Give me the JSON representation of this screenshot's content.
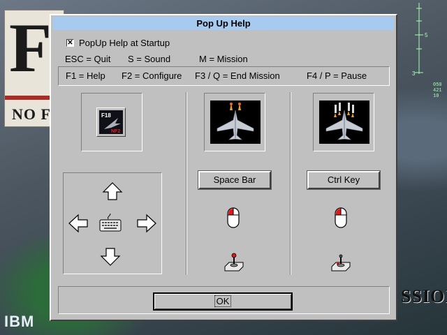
{
  "background": {
    "poster_letter": "F-",
    "poster_text": "NO F",
    "mission_text": "SSION",
    "ibm_logo": "IBM",
    "hud_numbers": [
      "050",
      "421",
      "10"
    ],
    "hud_scale": [
      "5",
      "3"
    ]
  },
  "dialog": {
    "title": "Pop Up Help",
    "startup_checkbox": {
      "label": "PopUp Help at Startup",
      "checked": true,
      "mark": "✕"
    },
    "keys_row1": [
      "ESC = Quit",
      "S = Sound",
      "M = Mission"
    ],
    "keys_row2": [
      "F1 = Help",
      "F2 = Configure",
      "F3 / Q = End Mission",
      "F4 / P = Pause"
    ],
    "panels": {
      "steer": {
        "logo_text": "F18",
        "logo_subtext": "NF2"
      },
      "fire_guns": {
        "key_label": "Space Bar"
      },
      "fire_missiles": {
        "key_label": "Ctrl Key"
      }
    },
    "ok_label": "OK"
  }
}
